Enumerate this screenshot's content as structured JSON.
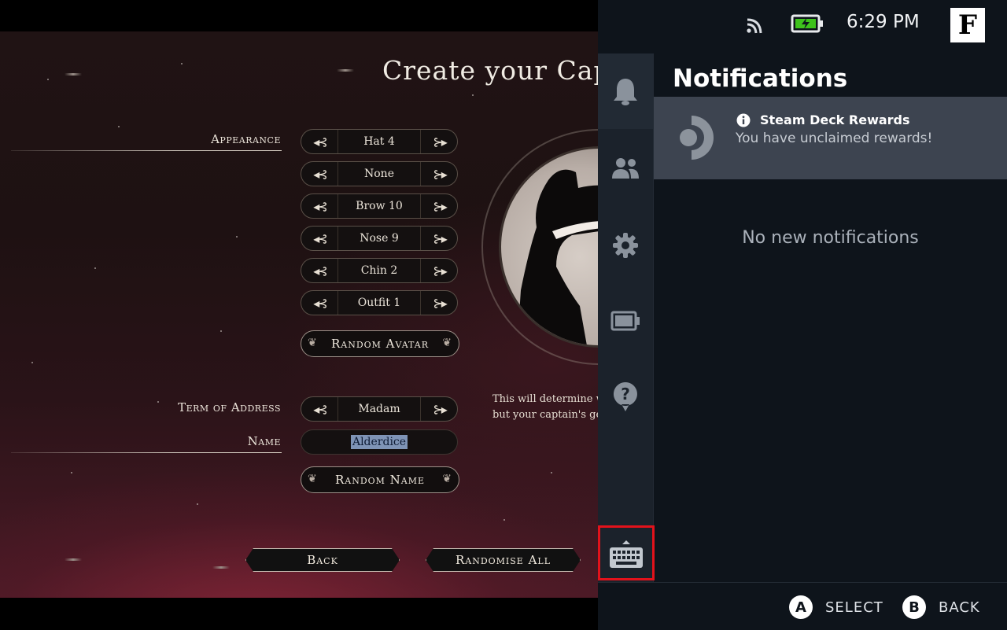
{
  "game": {
    "title": "Create your Capta",
    "appearance_label": "Appearance",
    "selectors": [
      {
        "value": "Hat 4"
      },
      {
        "value": "None"
      },
      {
        "value": "Brow 10"
      },
      {
        "value": "Nose 9"
      },
      {
        "value": "Chin 2"
      },
      {
        "value": "Outfit 1"
      }
    ],
    "random_avatar_label": "Random Avatar",
    "term_label": "Term of Address",
    "term_value": "Madam",
    "name_label": "Name",
    "name_value": "Alderdice",
    "random_name_label": "Random Name",
    "description_line1": "This will determine w",
    "description_line2": "but your captain's ge",
    "back_label": "Back",
    "randomise_all_label": "Randomise All",
    "arrow_left_glyph": "◂⊰",
    "arrow_right_glyph": "⊱▸"
  },
  "status_bar": {
    "time": "6:29 PM",
    "wifi_icon": "wifi-icon",
    "battery_icon": "battery-charging-icon",
    "app_icon": "app-logo-icon"
  },
  "qam": {
    "panel_title": "Notifications",
    "tabs": [
      {
        "icon": "bell-icon",
        "name": "Notifications"
      },
      {
        "icon": "friends-icon",
        "name": "Friends"
      },
      {
        "icon": "gear-icon",
        "name": "Settings"
      },
      {
        "icon": "battery-icon",
        "name": "Performance"
      },
      {
        "icon": "help-icon",
        "name": "Help"
      }
    ],
    "notification": {
      "title": "Steam Deck Rewards",
      "body": "You have unclaimed rewards!"
    },
    "empty_message": "No new notifications",
    "footer": {
      "a_glyph": "A",
      "a_label": "SELECT",
      "b_glyph": "B",
      "b_label": "BACK"
    }
  },
  "colors": {
    "highlight_border": "#e3121b",
    "panel_bg": "#0e141b",
    "rail_bg": "#1b222b",
    "card_bg": "#3d4450",
    "battery_green": "#3ec21c"
  }
}
